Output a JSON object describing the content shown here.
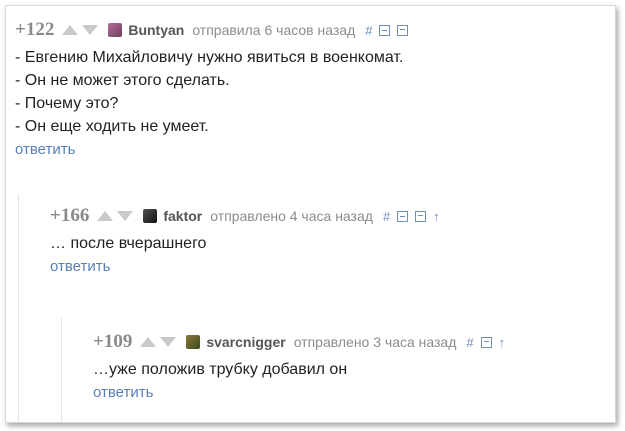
{
  "comments": [
    {
      "rating": "+122",
      "author": "Buntyan",
      "meta": "отправила 6 часов назад",
      "tools": [
        "#"
      ],
      "lines": [
        "- Евгению Михайловичу нужно явиться в военкомат.",
        "- Он не может этого сделать.",
        "- Почему это?",
        "- Он еще ходить не умеет."
      ],
      "reply": "ответить"
    },
    {
      "rating": "+166",
      "author": "faktor",
      "meta": "отправлено 4 часа назад",
      "tools": [
        "#",
        "↑"
      ],
      "lines": [
        "… после вчерашнего"
      ],
      "reply": "ответить"
    },
    {
      "rating": "+109",
      "author": "svarcnigger",
      "meta": "отправлено 3 часа назад",
      "tools": [
        "#",
        "↑"
      ],
      "lines": [
        "…уже положив трубку добавил он"
      ],
      "reply": "ответить"
    }
  ],
  "colors": {
    "link": "#5b7fb2",
    "rating": "#8a8a8a",
    "meta": "#8c8c8c"
  }
}
